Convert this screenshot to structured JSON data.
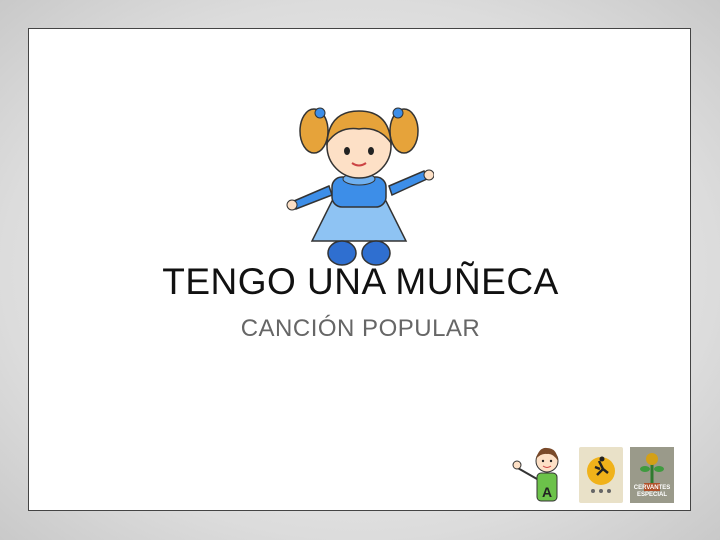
{
  "slide": {
    "title": "TENGO UNA MUÑECA",
    "subtitle": "CANCIÓN POPULAR"
  },
  "images": {
    "main": "doll-illustration",
    "logos": [
      "girl-with-letter-a-icon",
      "center-logo-badge",
      "school-logo-badge"
    ]
  },
  "badges": {
    "kid_letter": "A",
    "school_text": "CERVANTES ESPECIAL"
  },
  "colors": {
    "background_outer": "#dcdcdc",
    "slide_bg": "#ffffff",
    "title": "#111111",
    "subtitle": "#666666",
    "doll_dress": "#3d8ee8",
    "doll_hair": "#e6a33a"
  }
}
